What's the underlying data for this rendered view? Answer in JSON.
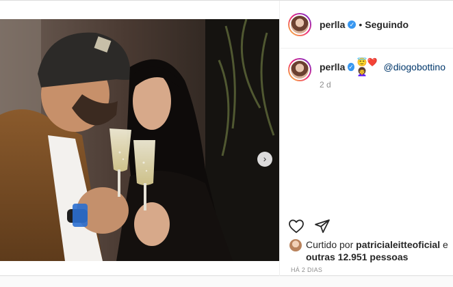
{
  "post": {
    "username": "perlla",
    "follow_label": "Seguindo",
    "dot": "•",
    "verified_glyph": "✓",
    "caption": {
      "username": "perlla",
      "emojis": "😇❤️👩‍🦱",
      "mention": "@diogobottino",
      "time": "2 d"
    },
    "likes": {
      "liked_by_prefix": "Curtido por",
      "liked_by_user": "patricialeitteoficial",
      "and_label": "e",
      "others": "outras 12.951 pessoas"
    },
    "posted_ago": "HÁ 2 DIAS",
    "carousel": {
      "next_glyph": "›"
    }
  },
  "icons": {
    "like": "heart-icon",
    "share": "share-icon",
    "next": "chevron-right-icon",
    "verified": "verified-badge-icon"
  },
  "colors": {
    "verified_blue": "#3897f0",
    "mention_blue": "#00376b",
    "muted": "#8e8e8e"
  }
}
